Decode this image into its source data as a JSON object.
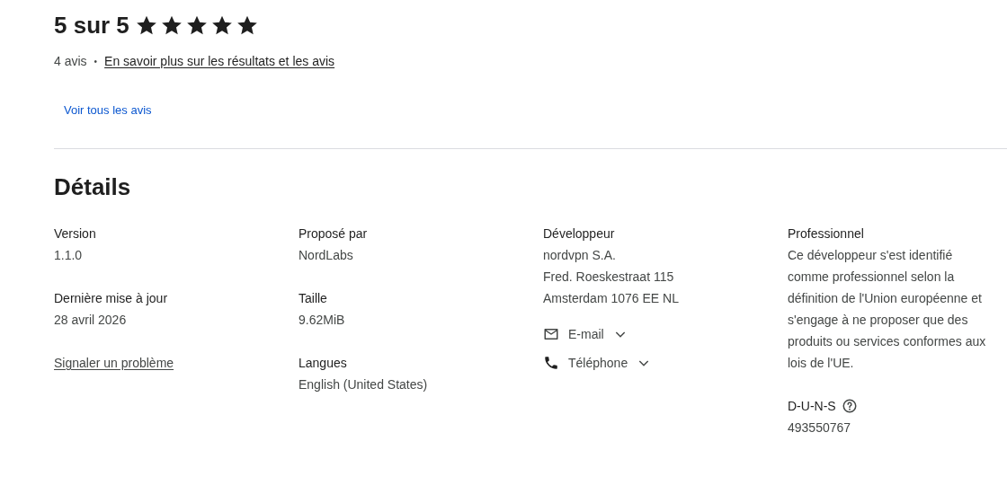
{
  "rating": {
    "title": "5 sur 5",
    "stars": 5,
    "count": "4 avis",
    "separator": "•",
    "learn_link": "En savoir plus sur les résultats et les avis",
    "all_button": "Voir tous les avis"
  },
  "details": {
    "title": "Détails",
    "columns": [
      [
        {
          "kind": "field",
          "label": "Version",
          "lines": [
            "1.1.0"
          ]
        },
        {
          "kind": "field",
          "label": "Dernière mise à jour",
          "lines": [
            "28 avril 2026"
          ]
        },
        {
          "kind": "link",
          "text": "Signaler un problème"
        }
      ],
      [
        {
          "kind": "field",
          "label": "Proposé par",
          "lines": [
            "NordLabs"
          ]
        },
        {
          "kind": "field",
          "label": "Taille",
          "lines": [
            "9.62MiB"
          ]
        },
        {
          "kind": "field",
          "label": "Langues",
          "lines": [
            "English (United States)"
          ]
        }
      ],
      [
        {
          "kind": "field",
          "label": "Développeur",
          "lines": [
            "nordvpn S.A.",
            "Fred. Roeskestraat 115",
            "Amsterdam 1076 EE NL"
          ]
        },
        {
          "kind": "email",
          "label": "E-mail",
          "expanded": false
        },
        {
          "kind": "phone",
          "label": "Téléphone",
          "expanded": false
        }
      ],
      [
        {
          "kind": "paragraph",
          "label": "Professionnel",
          "text": "Ce développeur s'est identifié comme professionnel selon la définition de l'Union européenne et s'engage à ne proposer que des produits ou services conformes aux lois de l'UE."
        },
        {
          "kind": "field",
          "label": "D-U-N-S",
          "help": true,
          "lines": [
            "493550767"
          ]
        }
      ]
    ]
  }
}
